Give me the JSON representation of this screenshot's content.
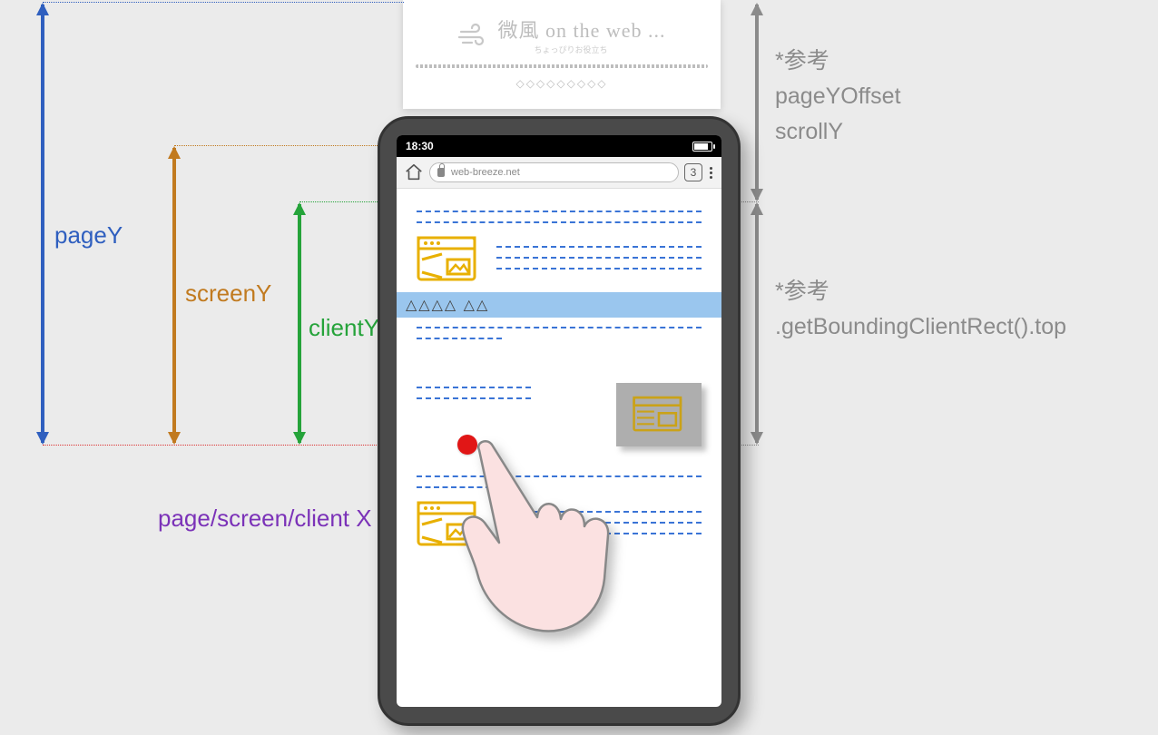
{
  "labels": {
    "pageY": "pageY",
    "screenY": "screenY",
    "clientY": "clientY",
    "x_combined": "page/screen/client X",
    "ref_mark": "*参考",
    "ref1_line1": "pageYOffset",
    "ref1_line2": "scrollY",
    "ref2_line1": ".getBoundingClientRect().top"
  },
  "page_behind": {
    "logo_text": "微風 on the web ...",
    "logo_sub": "ちょっぴりお役立ち",
    "content_top": "◇◇◇◇◇◇◇◇◇"
  },
  "phone": {
    "time": "18:30",
    "url": "web-breeze.net",
    "tab_count": "3",
    "heading": "△△△△  △△"
  }
}
